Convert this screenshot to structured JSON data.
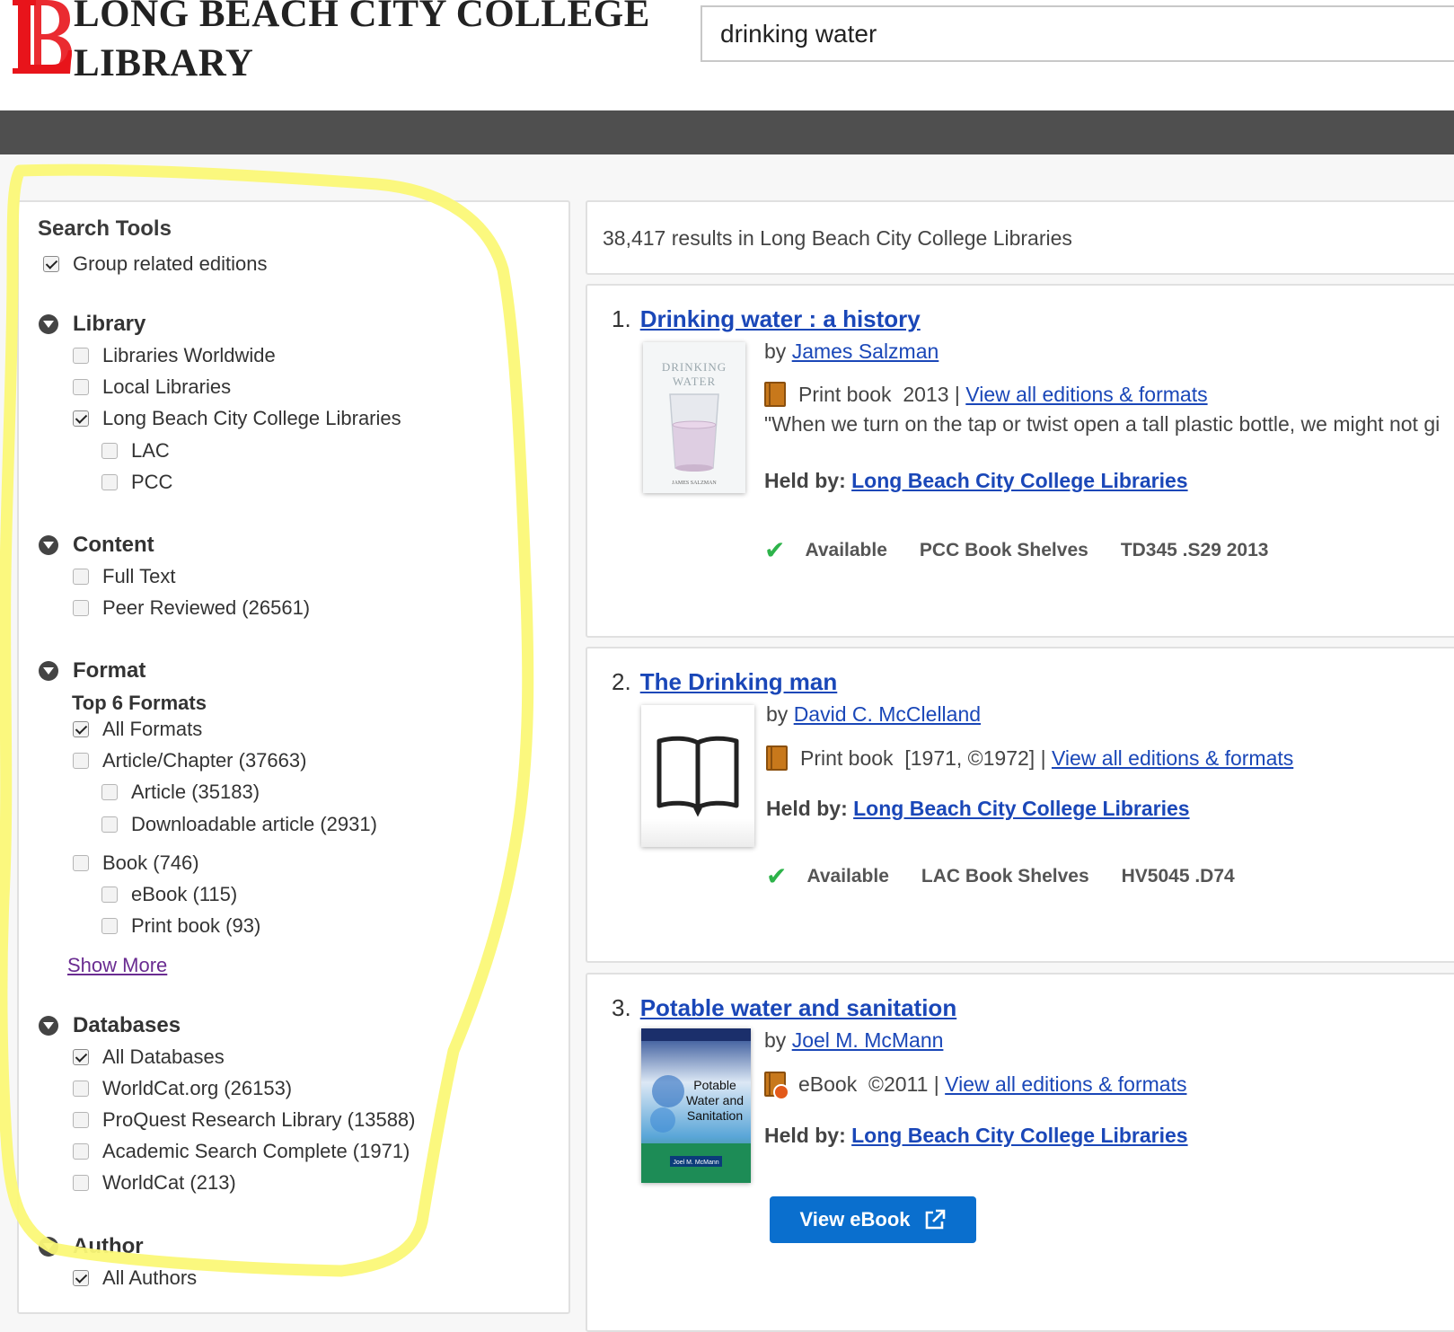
{
  "header": {
    "logo_line1": "Long Beach City College",
    "logo_line2": "Library",
    "search_value": "drinking water"
  },
  "sidebar": {
    "title": "Search Tools",
    "group_related": "Group related editions",
    "library": {
      "heading": "Library",
      "items": [
        "Libraries Worldwide",
        "Local Libraries",
        "Long Beach City College Libraries",
        "LAC",
        "PCC"
      ]
    },
    "content": {
      "heading": "Content",
      "items": [
        "Full Text",
        "Peer Reviewed (26561)"
      ]
    },
    "format": {
      "heading": "Format",
      "subheading": "Top 6 Formats",
      "items": [
        "All Formats",
        "Article/Chapter (37663)",
        "Article (35183)",
        "Downloadable article (2931)",
        "Book (746)",
        "eBook (115)",
        "Print book (93)"
      ],
      "show_more": "Show More"
    },
    "databases": {
      "heading": "Databases",
      "items": [
        "All Databases",
        "WorldCat.org (26153)",
        "ProQuest Research Library (13588)",
        "Academic Search Complete (1971)",
        "WorldCat (213)"
      ]
    },
    "author": {
      "heading": "Author",
      "items": [
        "All Authors"
      ]
    }
  },
  "results": {
    "count_text": "38,417 results in Long Beach City College Libraries",
    "items": [
      {
        "num": "1.",
        "title": "Drinking water : a history",
        "by": "by",
        "author": "James Salzman",
        "format": "Print book",
        "date": "2013",
        "sep": "|",
        "editions": "View all editions & formats",
        "snippet": "\"When we turn on the tap or twist open a tall plastic bottle, we might not gi",
        "held_label": "Held by:",
        "held_by": "Long Beach City College Libraries",
        "availability": "Available",
        "location": "PCC Book Shelves",
        "call_number": "TD345 .S29 2013",
        "cover_title": "DRINKING WATER",
        "cover_author": "JAMES SALZMAN"
      },
      {
        "num": "2.",
        "title": "The Drinking man",
        "by": "by",
        "author": "David C. McClelland",
        "format": "Print book",
        "date": "[1971, ©1972]",
        "sep": "|",
        "editions": "View all editions & formats",
        "held_label": "Held by:",
        "held_by": "Long Beach City College Libraries",
        "availability": "Available",
        "location": "LAC Book Shelves",
        "call_number": "HV5045 .D74"
      },
      {
        "num": "3.",
        "title": "Potable water and sanitation",
        "by": "by",
        "author": "Joel M. McMann",
        "format": "eBook",
        "date": "©2011",
        "sep": "|",
        "editions": "View all editions & formats",
        "held_label": "Held by:",
        "held_by": "Long Beach City College Libraries",
        "button": "View eBook",
        "cover_title": "Potable Water and Sanitation",
        "cover_author": "Joel M. McMann"
      }
    ]
  },
  "colors": {
    "link": "#1a47b8",
    "logo_red": "#e8141b",
    "highlight": "#fbf877",
    "button": "#0a6fce",
    "available": "#2db34a"
  }
}
